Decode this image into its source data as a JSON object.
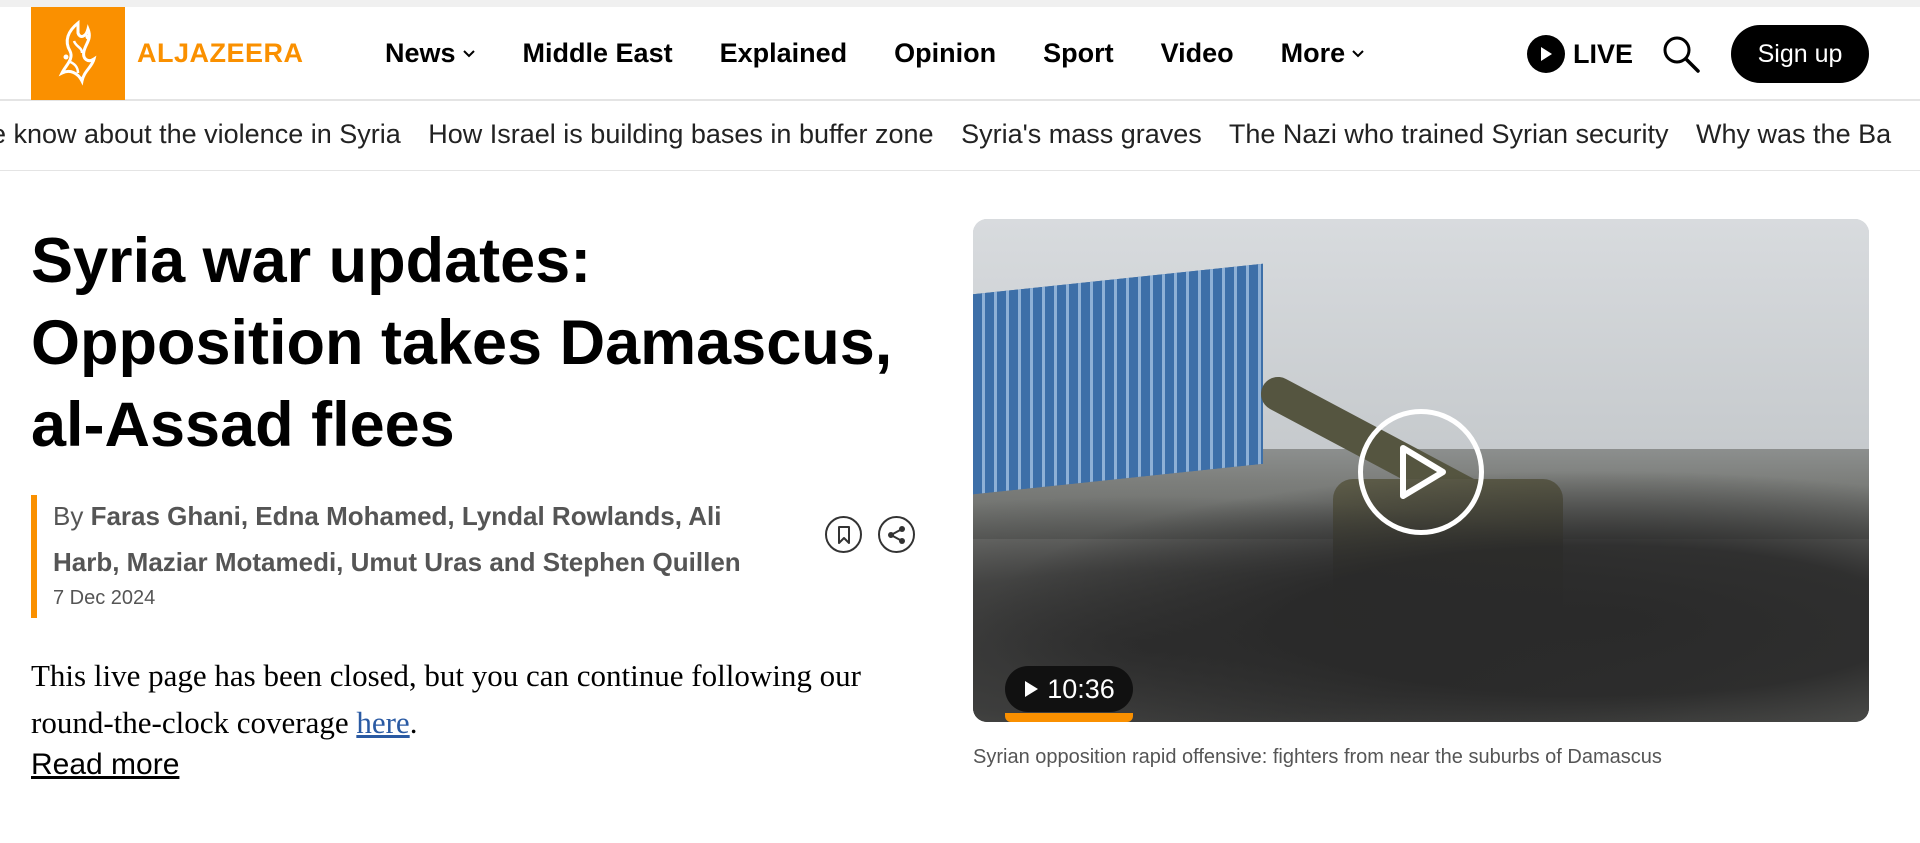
{
  "header": {
    "brand": "ALJAZEERA",
    "nav": [
      {
        "label": "News",
        "dropdown": true
      },
      {
        "label": "Middle East",
        "dropdown": false
      },
      {
        "label": "Explained",
        "dropdown": false
      },
      {
        "label": "Opinion",
        "dropdown": false
      },
      {
        "label": "Sport",
        "dropdown": false
      },
      {
        "label": "Video",
        "dropdown": false
      },
      {
        "label": "More",
        "dropdown": true
      }
    ],
    "live_label": "LIVE",
    "signup_label": "Sign up"
  },
  "ticker": [
    "re know about the violence in Syria",
    "How Israel is building bases in buffer zone",
    "Syria's mass graves",
    "The Nazi who trained Syrian security",
    "Why was the Ba"
  ],
  "article": {
    "title": "Syria war updates: Opposition takes Damascus, al-Assad flees",
    "byline_prefix": "By",
    "authors": "Faras Ghani, Edna Mohamed, Lyndal Rowlands, Ali Harb, Maziar Motamedi, Umut Uras and Stephen Quillen",
    "date": "7 Dec 2024",
    "summary_text": "This live page has been closed, but you can continue following our round-the-clock coverage ",
    "summary_link": "here",
    "summary_end": ".",
    "read_more": "Read more"
  },
  "video": {
    "duration": "10:36",
    "progress": 0,
    "caption": "Syrian opposition rapid offensive: fighters from near the suburbs of Damascus"
  },
  "colors": {
    "brand_orange": "#fa9000",
    "link_blue": "#2a5aa3"
  }
}
